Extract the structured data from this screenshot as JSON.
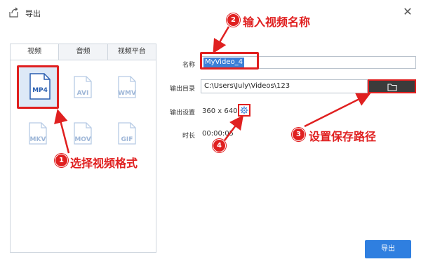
{
  "window": {
    "title": "导出",
    "close_symbol": "✕"
  },
  "tabs": [
    {
      "label": "视频",
      "active": true
    },
    {
      "label": "音频",
      "active": false
    },
    {
      "label": "视频平台",
      "active": false
    }
  ],
  "formats": [
    {
      "label": "MP4",
      "selected": true
    },
    {
      "label": "AVI",
      "selected": false
    },
    {
      "label": "WMV",
      "selected": false
    },
    {
      "label": "MKV",
      "selected": false
    },
    {
      "label": "MOV",
      "selected": false
    },
    {
      "label": "GIF",
      "selected": false
    }
  ],
  "form": {
    "name_label": "名称",
    "name_value": "MyVideo_4",
    "dir_label": "输出目录",
    "dir_value": "C:\\Users\\July\\Videos\\123",
    "settings_label": "输出设置",
    "settings_value": "360 x 640",
    "duration_label": "时长",
    "duration_value": "00:00:05"
  },
  "export_button": "导出",
  "annotations": [
    {
      "number": "1",
      "text": "选择视频格式"
    },
    {
      "number": "2",
      "text": "输入视频名称"
    },
    {
      "number": "3",
      "text": "设置保存路径"
    },
    {
      "number": "4",
      "text": ""
    }
  ],
  "colors": {
    "accent": "#2f7fe0",
    "annotation": "#e02020",
    "selection_bg": "#dde9f7"
  }
}
